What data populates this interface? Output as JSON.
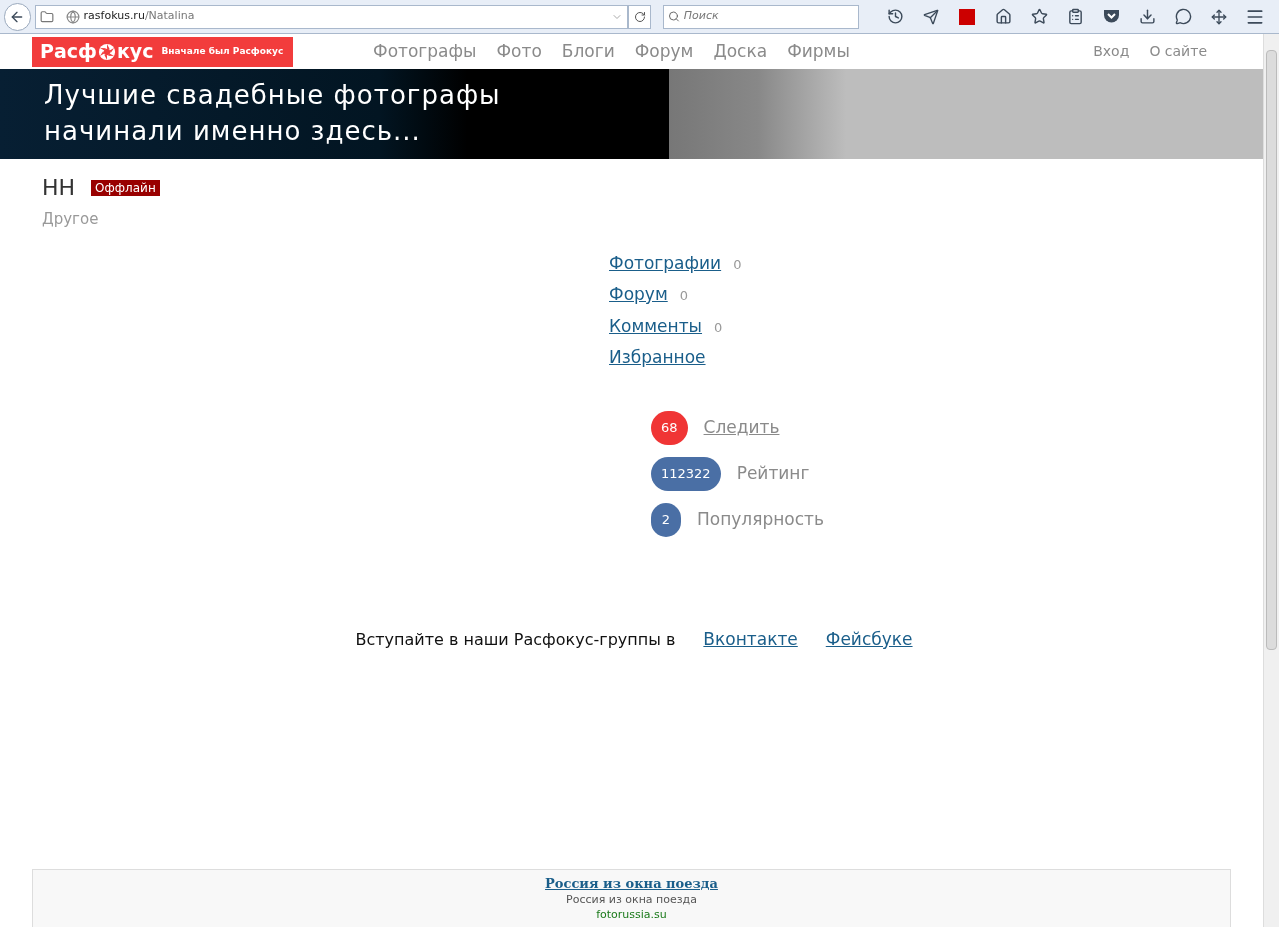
{
  "browser": {
    "url_domain": "rasfokus.ru",
    "url_path": "/Natalina",
    "search_placeholder": "Поиск"
  },
  "site": {
    "logo_before": "Расф",
    "logo_after": "кус",
    "tagline": "Вначале был Расфокус",
    "nav": [
      "Фотографы",
      "Фото",
      "Блоги",
      "Форум",
      "Доска",
      "Фирмы"
    ],
    "account_links": [
      "Вход",
      "О сайте"
    ]
  },
  "banner": {
    "lines": [
      "Лучшие свадебные фотографы",
      "начинали именно здесь..."
    ]
  },
  "profile": {
    "name": "НН",
    "status": "Оффлайн",
    "online": false,
    "category": "Другое"
  },
  "sections": [
    {
      "label": "Фотографии",
      "count": "0"
    },
    {
      "label": "Форум",
      "count": "0"
    },
    {
      "label": "Комменты",
      "count": "0"
    },
    {
      "label": "Избранное"
    }
  ],
  "stats": [
    {
      "value": "68",
      "label": "Следить",
      "kind": "link",
      "color": "#f03535"
    },
    {
      "value": "112322",
      "label": "Рейтинг",
      "kind": "label",
      "color": "#4a6fa5"
    },
    {
      "value": "2",
      "label": "Популярность",
      "kind": "label",
      "color": "#4a6fa5"
    }
  ],
  "social": {
    "text": "Вступайте в наши Расфокус-группы в",
    "links": [
      "Вконтакте",
      "Фейсбуке"
    ]
  },
  "ad": {
    "title": "Россия из окна поезда",
    "description": "Россия из окна поезда",
    "domain": "fotorussia.su"
  }
}
